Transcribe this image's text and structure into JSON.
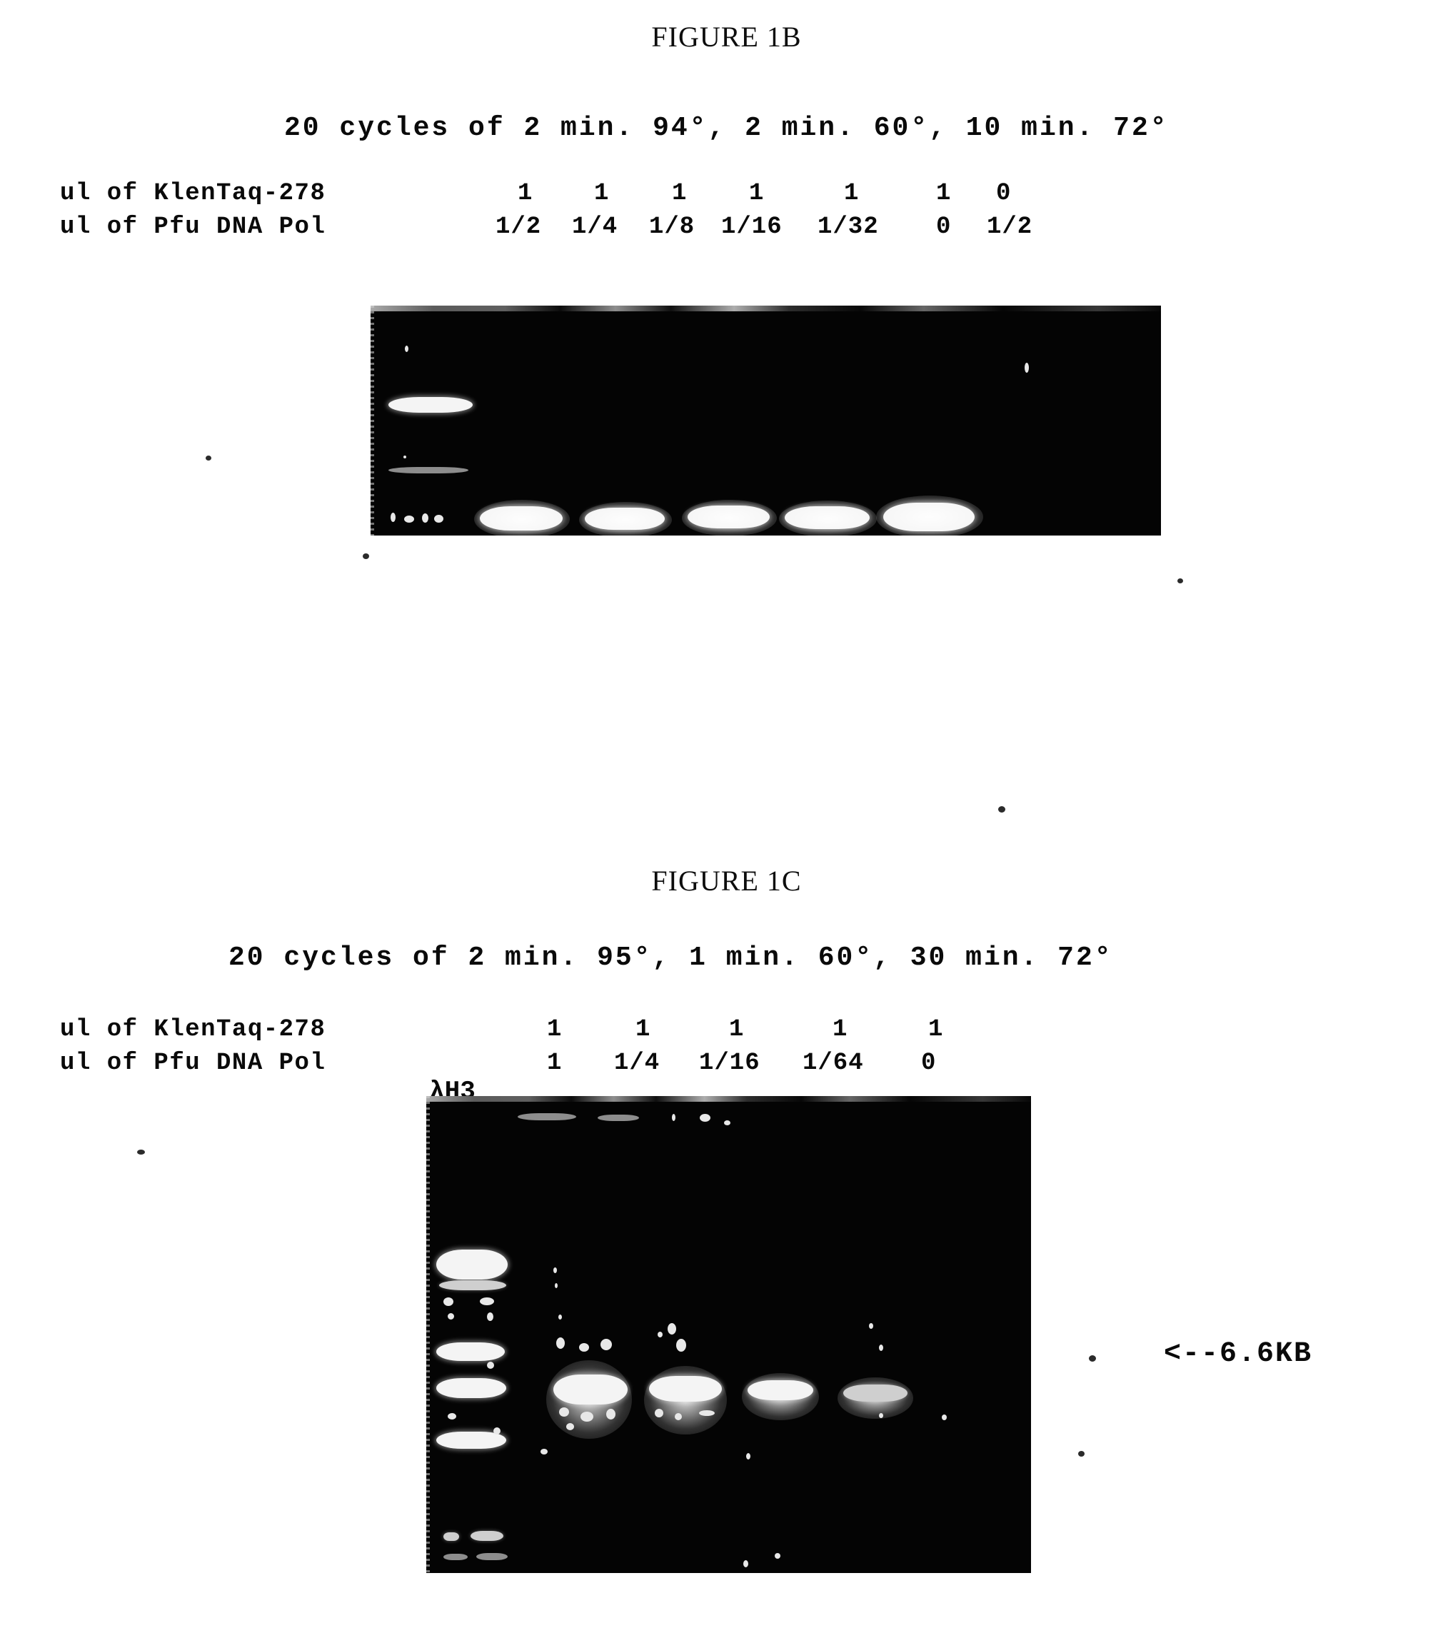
{
  "figures": [
    {
      "id": "1b",
      "caption": "FIGURE 1B",
      "conditions": "20 cycles of 2 min. 94°, 2 min. 60°, 10 min. 72°",
      "rows": [
        {
          "label": "ul of KlenTaq-278",
          "values": [
            "1",
            "1",
            "1",
            "1",
            "1",
            "1",
            "0"
          ]
        },
        {
          "label": "ul of Pfu DNA Pol",
          "values": [
            "1/2",
            "1/4",
            "1/8",
            "1/16",
            "1/32",
            "0",
            "1/2"
          ]
        }
      ],
      "gel": {
        "background_color": "#040404",
        "band_color": "#f4f4f4",
        "lanes": 7,
        "marker_lane_label": "",
        "product_bands": 5,
        "description": "agarose gel, bright product bands in lanes 1-5, none in lanes 6-7"
      }
    },
    {
      "id": "1c",
      "caption": "FIGURE 1C",
      "conditions": "20 cycles of 2 min. 95°, 1 min. 60°, 30 min. 72°",
      "rows": [
        {
          "label": "ul of KlenTaq-278",
          "values": [
            "1",
            "1",
            "1",
            "1",
            "1"
          ]
        },
        {
          "label": "ul of Pfu DNA Pol",
          "values": [
            "1",
            "1/4",
            "1/16",
            "1/64",
            "0"
          ]
        }
      ],
      "marker_label": "λH3",
      "size_annotation": "<--6.6KB",
      "gel": {
        "background_color": "#040404",
        "band_color": "#f4f4f4",
        "lanes": 5,
        "marker_lane_label": "λH3",
        "product_bands": 4,
        "description": "agarose gel with lambda HindIII marker ladder at left, decreasing product intensity across lanes 1-4, none in lane 5"
      }
    }
  ]
}
